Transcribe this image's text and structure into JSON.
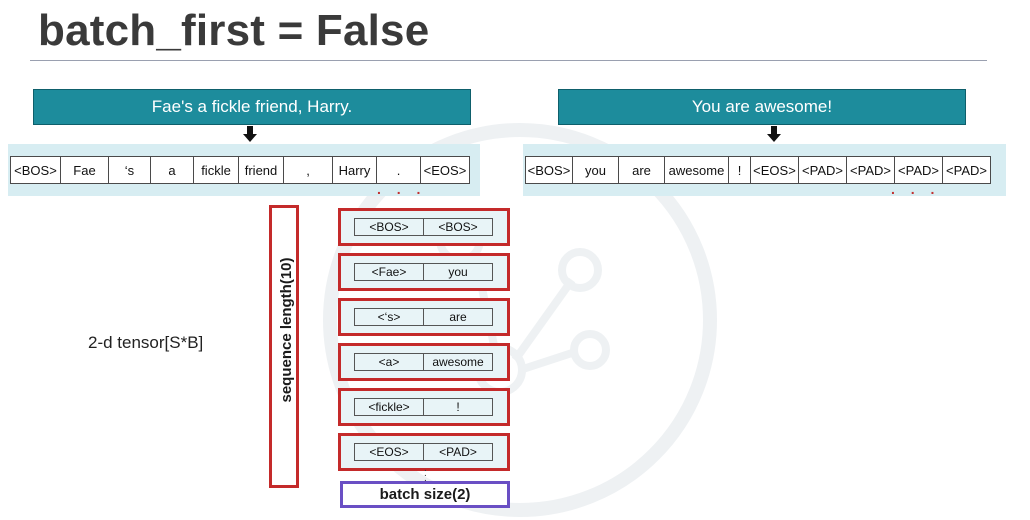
{
  "slide": {
    "title": "batch_first = False"
  },
  "sentences": [
    {
      "text": "Fae's a fickle friend, Harry.",
      "tokens": [
        "<BOS>",
        "Fae",
        "‘s",
        "a",
        "fickle",
        "friend",
        ",",
        "Harry",
        ".",
        "<EOS>"
      ],
      "ellipsis": ". . ."
    },
    {
      "text": "You are awesome!",
      "tokens": [
        "<BOS>",
        "you",
        "are",
        "awesome",
        "!",
        "<EOS>",
        "<PAD>",
        "<PAD>",
        "<PAD>",
        "<PAD>"
      ],
      "ellipsis": ". . ."
    }
  ],
  "tensor_label": "2-d tensor[S*B]",
  "sequence_label": "sequence length(10)",
  "steps": [
    {
      "a": "<BOS>",
      "b": "<BOS>"
    },
    {
      "a": "<Fae>",
      "b": "you"
    },
    {
      "a": "<‘s>",
      "b": "are"
    },
    {
      "a": "<a>",
      "b": "awesome"
    },
    {
      "a": "<fickle>",
      "b": "!"
    },
    {
      "a": "<EOS>",
      "b": "<PAD>"
    }
  ],
  "batch_label": "batch size(2)",
  "colors": {
    "sentence_box": "#1d8c9c",
    "strip": "#d7edf2",
    "frame_red": "#c42a2a",
    "frame_purple": "#6a4fc4"
  },
  "icons": {
    "arrow": "down-arrow-icon",
    "watermark": "network-watermark-icon"
  }
}
